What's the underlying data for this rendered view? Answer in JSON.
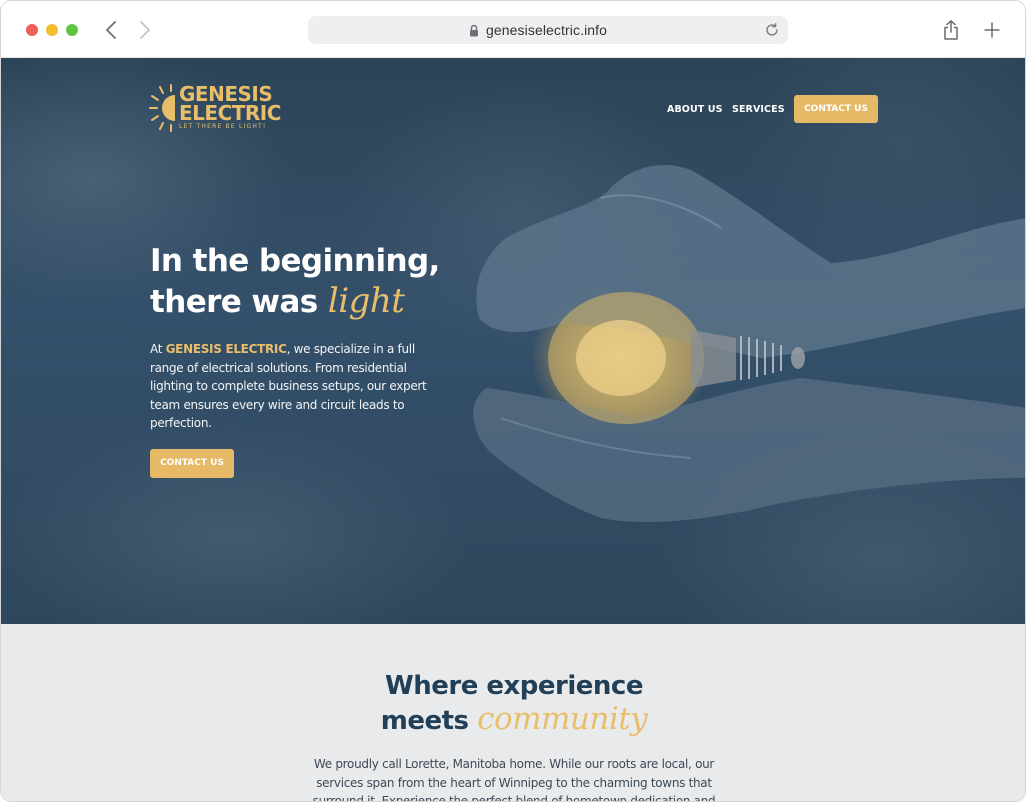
{
  "browser": {
    "url": "genesiselectric.info"
  },
  "brand": {
    "name_line1": "GENESIS",
    "name_line2": "ELECTRIC",
    "tagline": "LET THERE BE LIGHT!"
  },
  "nav": {
    "about": "ABOUT US",
    "services": "SERVICES",
    "contact": "CONTACT US"
  },
  "hero": {
    "headline_line1": "In the beginning,",
    "headline_line2_prefix": "there was ",
    "headline_line2_accent": "light",
    "intro_prefix": "At ",
    "intro_brand": "GENESIS ELECTRIC",
    "intro_rest": ", we specialize in a full range of electrical solutions. From residential lighting to complete business setups, our expert team ensures every wire and circuit leads to perfection.",
    "cta": "CONTACT US"
  },
  "community": {
    "title_line1": "Where experience",
    "title_line2_prefix": "meets ",
    "title_line2_accent": "community",
    "paragraph": "We proudly call Lorette, Manitoba home. While our roots are local, our services span from the heart of Winnipeg to the charming towns that surround it. Experience the perfect blend of hometown dedication and"
  },
  "colors": {
    "accent": "#e6b966",
    "navy": "#213f56",
    "hero_overlay": "#2f4a5f",
    "section_bg": "#e9eaec"
  },
  "icons": [
    "back-icon",
    "forward-icon",
    "lock-icon",
    "reload-icon",
    "share-icon",
    "new-tab-icon",
    "sun-logo-icon"
  ]
}
